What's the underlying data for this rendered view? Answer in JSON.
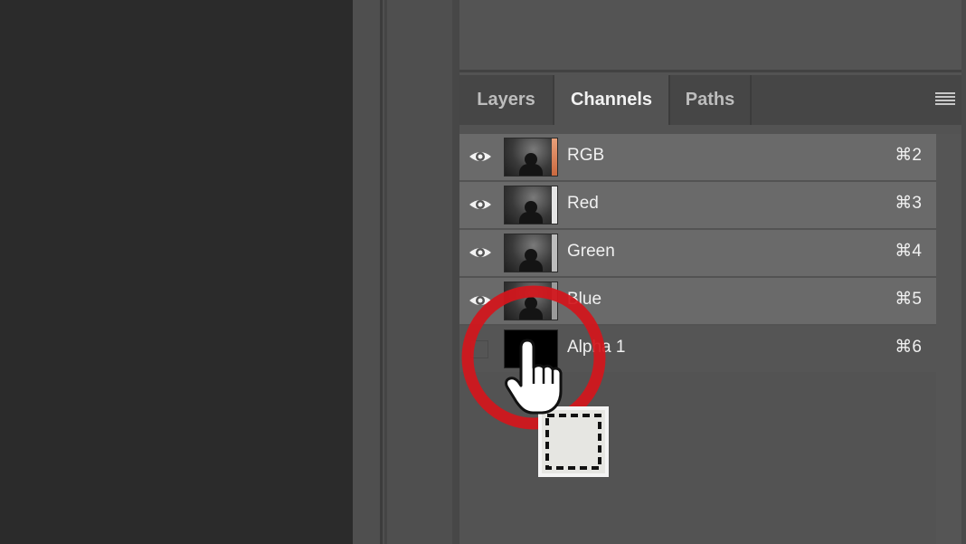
{
  "tabs": [
    {
      "label": "Layers",
      "active": false
    },
    {
      "label": "Channels",
      "active": true
    },
    {
      "label": "Paths",
      "active": false
    }
  ],
  "panel_menu_icon": "hamburger-menu-icon",
  "channels": [
    {
      "name": "RGB",
      "shortcut": "⌘2",
      "visible": true
    },
    {
      "name": "Red",
      "shortcut": "⌘3",
      "visible": true
    },
    {
      "name": "Green",
      "shortcut": "⌘4",
      "visible": true
    },
    {
      "name": "Blue",
      "shortcut": "⌘5",
      "visible": true
    },
    {
      "name": "Alpha 1",
      "shortcut": "⌘6",
      "visible": false
    }
  ],
  "alpha_thumb_mark": "1",
  "overlay": {
    "highlight_color": "#d3161c",
    "cursor_icon": "hand-pointer-icon",
    "drag_icon": "dashed-selection-icon"
  }
}
